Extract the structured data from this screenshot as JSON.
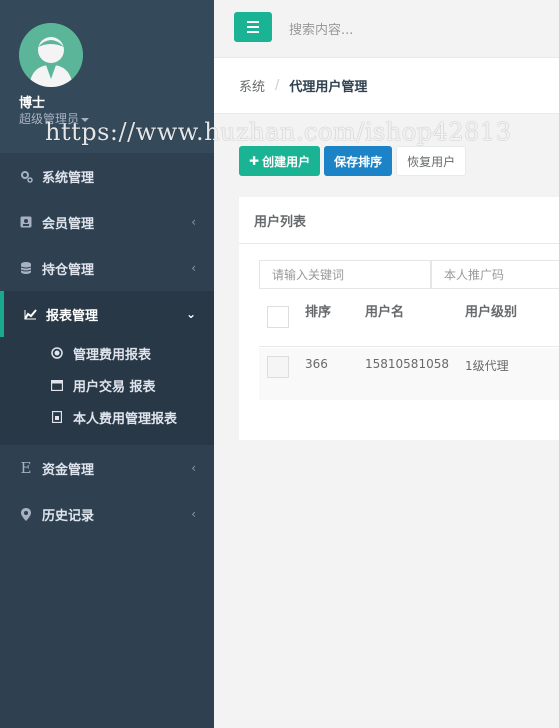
{
  "profile": {
    "name": "博士",
    "role": "超级管理员"
  },
  "watermark": "https://www.huzhan.com/ishop42813",
  "sidebar": {
    "items": [
      {
        "label": "系统管理",
        "icon": "gears-icon"
      },
      {
        "label": "会员管理",
        "icon": "user-card-icon"
      },
      {
        "label": "持仓管理",
        "icon": "database-icon"
      },
      {
        "label": "报表管理",
        "icon": "chart-icon"
      },
      {
        "label": "资金管理",
        "icon": "euro-icon"
      },
      {
        "label": "历史记录",
        "icon": "map-pin-icon"
      }
    ],
    "subitems": [
      {
        "label": "管理费用报表",
        "icon": "circle-dot-icon"
      },
      {
        "label": "用户交易 报表",
        "icon": "window-icon"
      },
      {
        "label": "本人费用管理报表",
        "icon": "document-icon"
      }
    ]
  },
  "topbar": {
    "search_placeholder": "搜索内容..."
  },
  "breadcrumb": {
    "root": "系统",
    "sep": "/",
    "current": "代理用户管理"
  },
  "toolbar": {
    "create": "创建用户",
    "save": "保存排序",
    "restore": "恢复用户"
  },
  "panel": {
    "title": "用户列表",
    "keyword_placeholder": "请输入关键词",
    "referral_placeholder": "本人推广码",
    "columns": [
      "排序",
      "用户名",
      "用户级别"
    ],
    "rows": [
      {
        "sort": "366",
        "username": "15810581058",
        "level": "1级代理"
      }
    ]
  },
  "colors": {
    "accent": "#1ab394",
    "primary": "#1c84c6",
    "sidebar": "#2f4050"
  }
}
